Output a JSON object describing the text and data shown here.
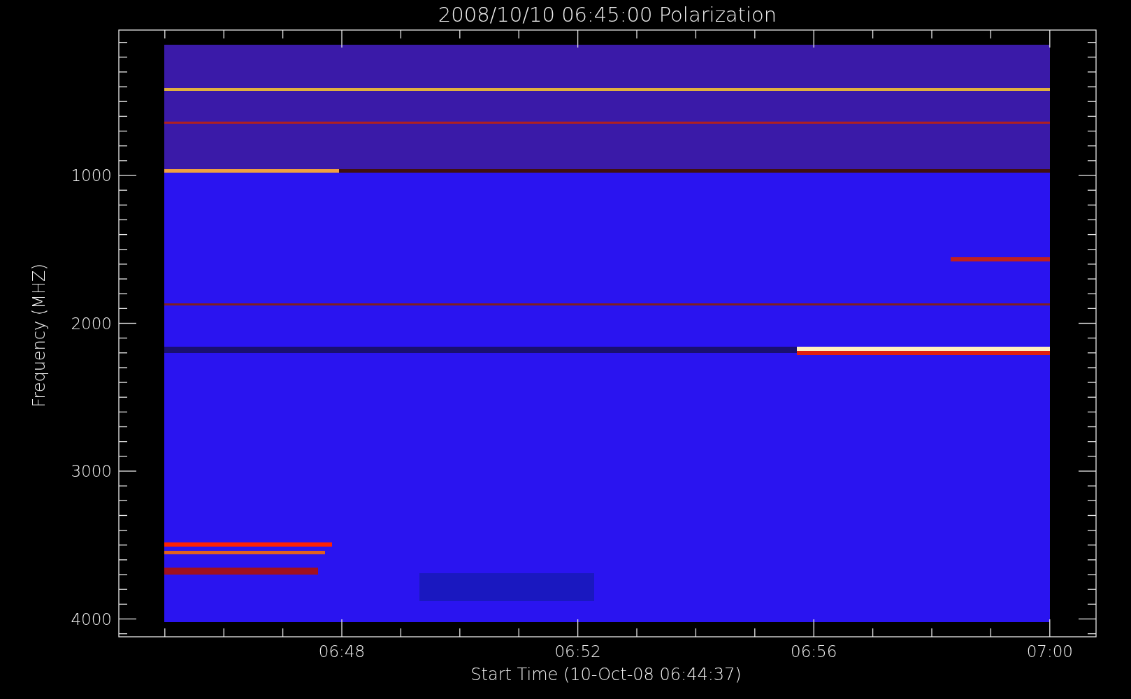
{
  "title": "2008/10/10 06:45:00 Polarization",
  "y_axis": {
    "label": "Frequency (MHZ)",
    "ticks": [
      "1000",
      "2000",
      "3000",
      "4000"
    ]
  },
  "x_axis": {
    "label": "Start Time (10-Oct-08 06:44:37)",
    "ticks": [
      "06:48",
      "06:52",
      "06:56",
      "07:00"
    ]
  }
}
